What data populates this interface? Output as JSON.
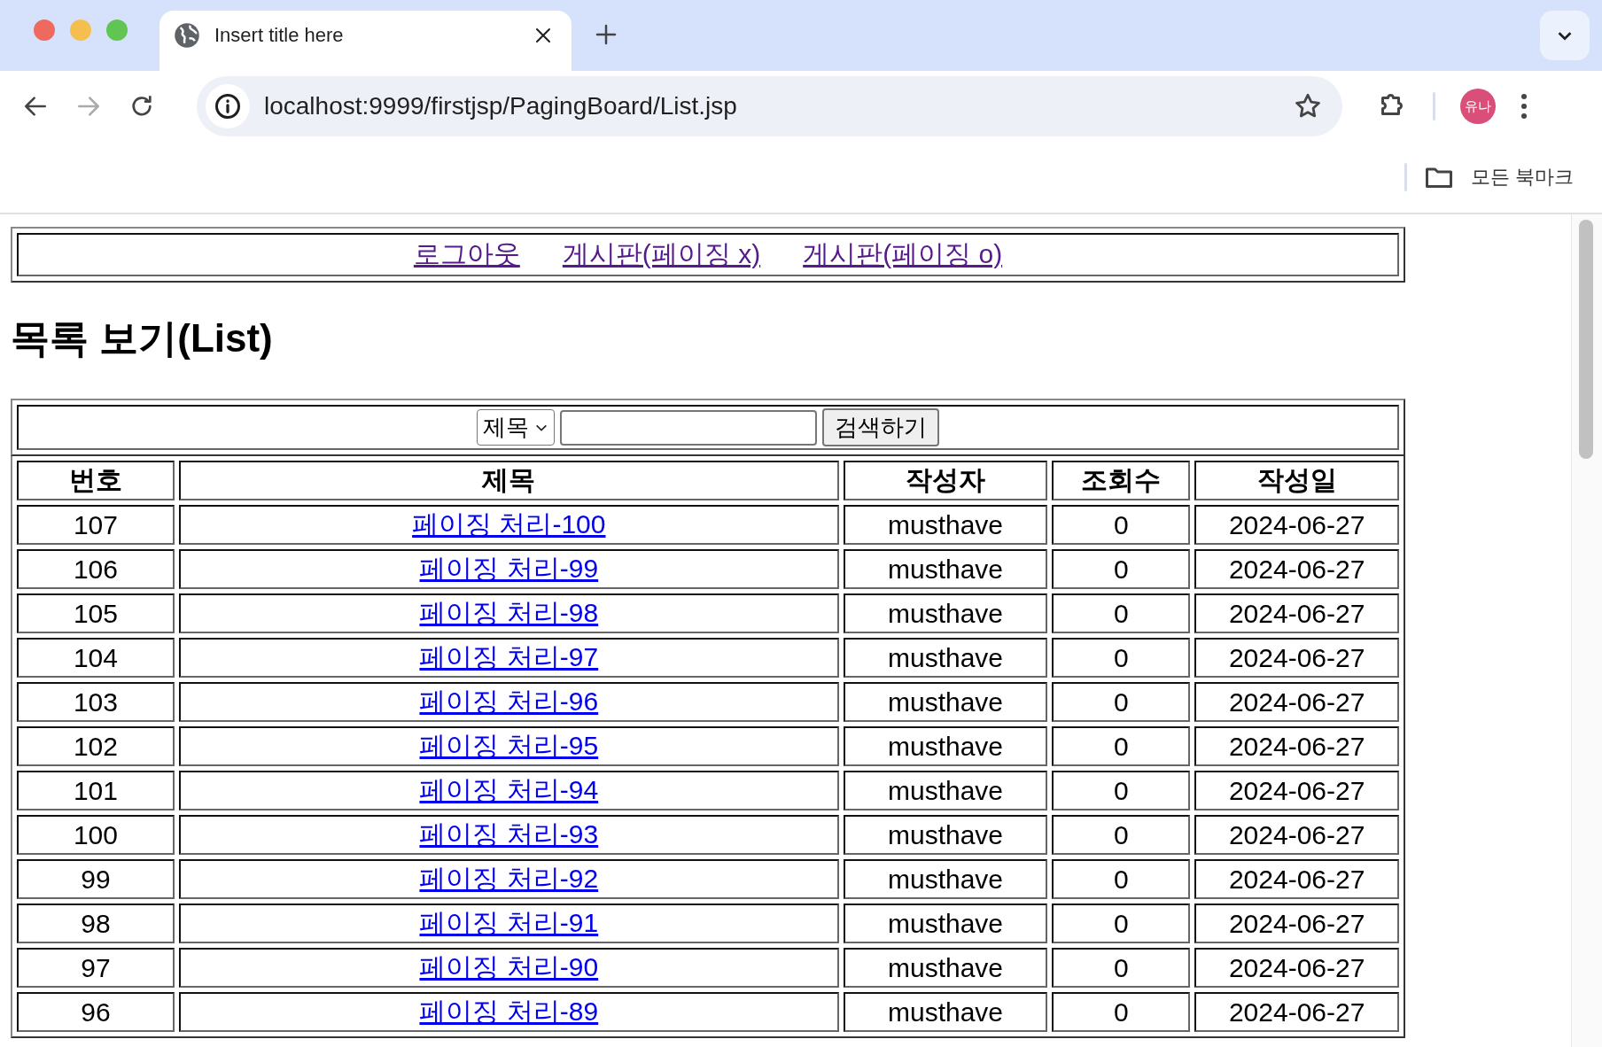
{
  "browser": {
    "tab": {
      "title": "Insert title here"
    },
    "url": "localhost:9999/firstjsp/PagingBoard/List.jsp",
    "profile": "유나",
    "bookmarks_label": "모든 북마크"
  },
  "nav_links": [
    {
      "label": "로그아웃",
      "visited": true
    },
    {
      "label": "게시판(페이징 x)",
      "visited": true
    },
    {
      "label": "게시판(페이징 o)",
      "visited": true
    }
  ],
  "heading": "목록 보기(List)",
  "search": {
    "field_select": "제목",
    "button": "검색하기"
  },
  "table": {
    "columns": [
      "번호",
      "제목",
      "작성자",
      "조회수",
      "작성일"
    ],
    "rows": [
      {
        "num": "107",
        "title": "페이징 처리-100",
        "author": "musthave",
        "views": "0",
        "date": "2024-06-27"
      },
      {
        "num": "106",
        "title": "페이징 처리-99",
        "author": "musthave",
        "views": "0",
        "date": "2024-06-27"
      },
      {
        "num": "105",
        "title": "페이징 처리-98",
        "author": "musthave",
        "views": "0",
        "date": "2024-06-27"
      },
      {
        "num": "104",
        "title": "페이징 처리-97",
        "author": "musthave",
        "views": "0",
        "date": "2024-06-27"
      },
      {
        "num": "103",
        "title": "페이징 처리-96",
        "author": "musthave",
        "views": "0",
        "date": "2024-06-27"
      },
      {
        "num": "102",
        "title": "페이징 처리-95",
        "author": "musthave",
        "views": "0",
        "date": "2024-06-27"
      },
      {
        "num": "101",
        "title": "페이징 처리-94",
        "author": "musthave",
        "views": "0",
        "date": "2024-06-27"
      },
      {
        "num": "100",
        "title": "페이징 처리-93",
        "author": "musthave",
        "views": "0",
        "date": "2024-06-27"
      },
      {
        "num": "99",
        "title": "페이징 처리-92",
        "author": "musthave",
        "views": "0",
        "date": "2024-06-27"
      },
      {
        "num": "98",
        "title": "페이징 처리-91",
        "author": "musthave",
        "views": "0",
        "date": "2024-06-27"
      },
      {
        "num": "97",
        "title": "페이징 처리-90",
        "author": "musthave",
        "views": "0",
        "date": "2024-06-27"
      },
      {
        "num": "96",
        "title": "페이징 처리-89",
        "author": "musthave",
        "views": "0",
        "date": "2024-06-27"
      }
    ]
  }
}
